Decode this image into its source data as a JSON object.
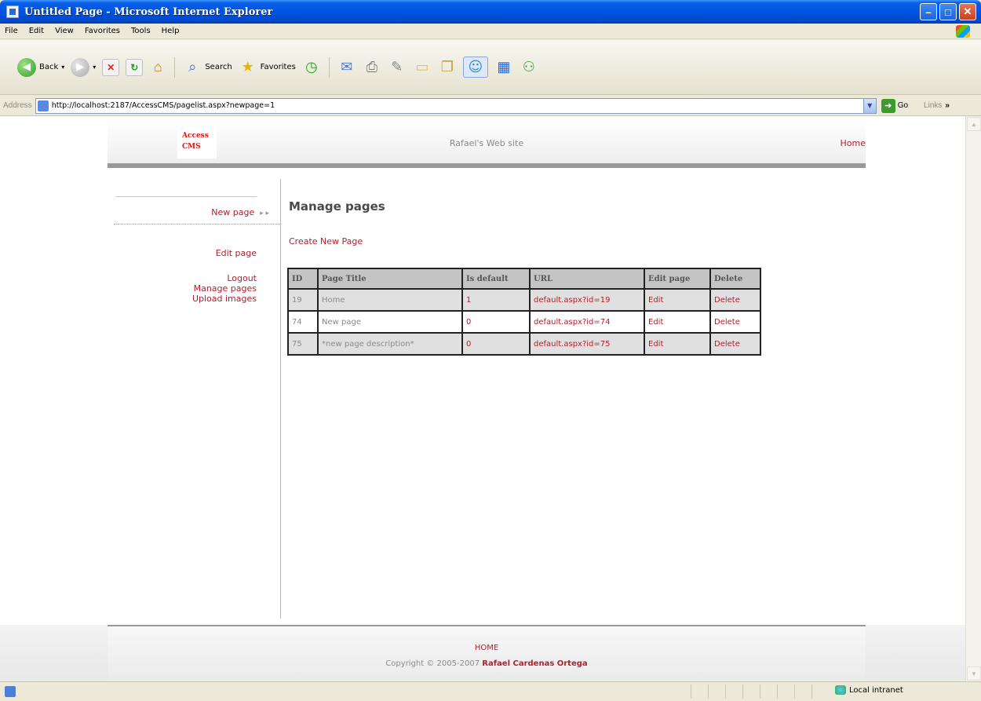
{
  "window": {
    "title": "Untitled Page - Microsoft Internet Explorer"
  },
  "menu": [
    "File",
    "Edit",
    "View",
    "Favorites",
    "Tools",
    "Help"
  ],
  "toolbar": {
    "back": "Back",
    "search": "Search",
    "favorites": "Favorites"
  },
  "address": {
    "label": "Address",
    "url": "http://localhost:2187/AccessCMS/pagelist.aspx?newpage=1",
    "go": "Go",
    "links": "Links"
  },
  "site": {
    "logo_line1": "Access",
    "logo_line2": "CMS",
    "title": "Rafael's Web site",
    "home": "Home"
  },
  "sidebar": {
    "active": "New page",
    "links": [
      "Edit page",
      "Logout",
      "Manage pages",
      "Upload images"
    ]
  },
  "main": {
    "heading": "Manage pages",
    "create_link": "Create New Page",
    "columns": [
      "ID",
      "Page Title",
      "Is default",
      "URL",
      "Edit page",
      "Delete"
    ],
    "rows": [
      {
        "id": "19",
        "title": "Home",
        "is_default": "1",
        "url": "default.aspx?id=19",
        "edit": "Edit",
        "delete": "Delete"
      },
      {
        "id": "74",
        "title": "New page",
        "is_default": "0",
        "url": "default.aspx?id=74",
        "edit": "Edit",
        "delete": "Delete"
      },
      {
        "id": "75",
        "title": "*new page description*",
        "is_default": "0",
        "url": "default.aspx?id=75",
        "edit": "Edit",
        "delete": "Delete"
      }
    ]
  },
  "footer": {
    "home": "HOME",
    "copyright": "Copyright © 2005-2007",
    "author": "Rafael Cardenas Ortega"
  },
  "status": {
    "zone": "Local intranet"
  },
  "colors": {
    "link": "#b02030",
    "logo": "#e01515",
    "titlebar": "#0054e3"
  }
}
